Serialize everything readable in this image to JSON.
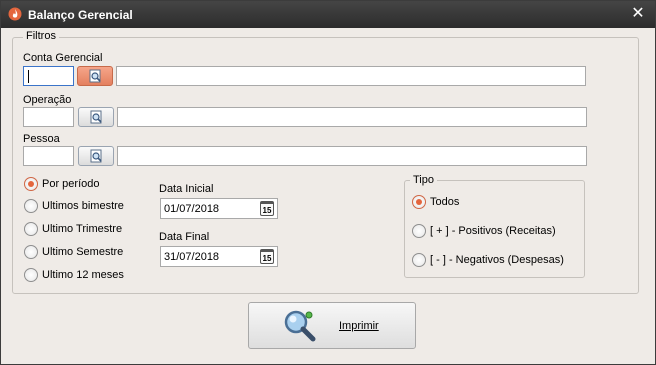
{
  "window": {
    "title": "Balanço Gerencial",
    "close_glyph": "✕",
    "title_icon": "flame-icon"
  },
  "filters": {
    "legend": "Filtros",
    "conta_gerencial": {
      "label": "Conta Gerencial",
      "code": "",
      "description": ""
    },
    "operacao": {
      "label": "Operação",
      "code": "",
      "description": ""
    },
    "pessoa": {
      "label": "Pessoa",
      "code": "",
      "description": ""
    },
    "periods": [
      {
        "label": "Por período",
        "checked": true
      },
      {
        "label": "Ultimos bimestre",
        "checked": false
      },
      {
        "label": "Ultimo Trimestre",
        "checked": false
      },
      {
        "label": "Ultimo Semestre",
        "checked": false
      },
      {
        "label": "Ultimo 12 meses",
        "checked": false
      }
    ],
    "data_inicial": {
      "label": "Data Inicial",
      "value": "01/07/2018",
      "calendar_glyph": "15"
    },
    "data_final": {
      "label": "Data Final",
      "value": "31/07/2018",
      "calendar_glyph": "15"
    },
    "tipo": {
      "legend": "Tipo",
      "options": [
        {
          "label": "Todos",
          "checked": true
        },
        {
          "label": "[ + ] - Positivos (Receitas)",
          "checked": false
        },
        {
          "label": "[ - ] - Negativos (Despesas)",
          "checked": false
        }
      ]
    }
  },
  "actions": {
    "print_label": "Imprimir"
  },
  "colors": {
    "accent": "#e4663e",
    "titlebar": "#333333",
    "background": "#efebe7"
  }
}
